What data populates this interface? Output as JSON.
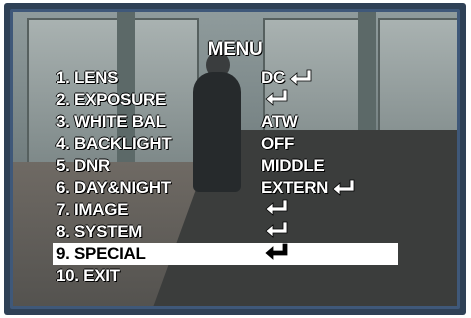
{
  "menu": {
    "title": "MENU",
    "items": [
      {
        "label": "1. LENS",
        "value": "DC",
        "enter": true
      },
      {
        "label": "2. EXPOSURE",
        "value": "",
        "enter": true
      },
      {
        "label": "3. WHITE BAL",
        "value": "ATW",
        "enter": false
      },
      {
        "label": "4. BACKLIGHT",
        "value": "OFF",
        "enter": false
      },
      {
        "label": "5. DNR",
        "value": "MIDDLE",
        "enter": false
      },
      {
        "label": "6. DAY&NIGHT",
        "value": "EXTERN",
        "enter": true
      },
      {
        "label": "7. IMAGE",
        "value": "",
        "enter": true
      },
      {
        "label": "8. SYSTEM",
        "value": "",
        "enter": true
      },
      {
        "label": "9. SPECIAL",
        "value": "",
        "enter": true
      },
      {
        "label": "10. EXIT",
        "value": "",
        "enter": false
      }
    ],
    "selected_index": 8
  },
  "icons": {
    "enter": "enter-arrow-icon"
  },
  "colors": {
    "osd_text": "#ffffff",
    "highlight_bg": "#ffffff",
    "bezel": "#3f5879"
  }
}
